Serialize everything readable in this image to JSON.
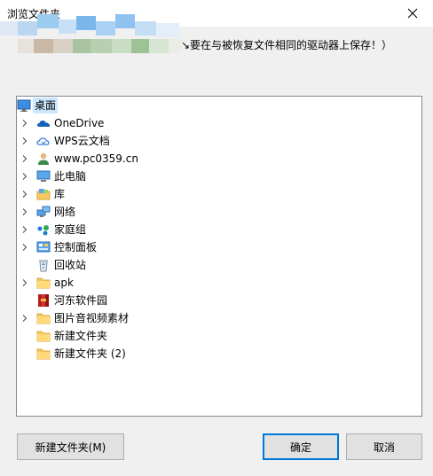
{
  "window": {
    "title": "浏览文件夹",
    "description": "↘要在与被恢复文件相同的驱动器上保存！）"
  },
  "tree": {
    "items": [
      {
        "label": "桌面",
        "icon": "desktop-icon",
        "expandable": false,
        "selected": true
      },
      {
        "label": "OneDrive",
        "icon": "onedrive-cloud-icon",
        "expandable": true
      },
      {
        "label": "WPS云文档",
        "icon": "wps-cloud-icon",
        "expandable": true
      },
      {
        "label": "www.pc0359.cn",
        "icon": "user-icon",
        "expandable": true
      },
      {
        "label": "此电脑",
        "icon": "computer-icon",
        "expandable": true
      },
      {
        "label": "库",
        "icon": "library-icon",
        "expandable": true
      },
      {
        "label": "网络",
        "icon": "network-icon",
        "expandable": true
      },
      {
        "label": "家庭组",
        "icon": "homegroup-icon",
        "expandable": true
      },
      {
        "label": "控制面板",
        "icon": "control-panel-icon",
        "expandable": true
      },
      {
        "label": "回收站",
        "icon": "recycle-bin-icon",
        "expandable": false
      },
      {
        "label": "apk",
        "icon": "folder-icon",
        "expandable": true
      },
      {
        "label": "河东软件园",
        "icon": "archive-icon",
        "expandable": false
      },
      {
        "label": "图片音视频素材",
        "icon": "folder-icon",
        "expandable": true
      },
      {
        "label": "新建文件夹",
        "icon": "folder-icon",
        "expandable": false
      },
      {
        "label": "新建文件夹 (2)",
        "icon": "folder-icon",
        "expandable": false
      }
    ]
  },
  "buttons": {
    "new_folder": "新建文件夹(M)",
    "ok": "确定",
    "cancel": "取消"
  },
  "colors": {
    "selection": "#cce8ff",
    "default_button_border": "#0078d7",
    "folder": "#f5c862"
  }
}
